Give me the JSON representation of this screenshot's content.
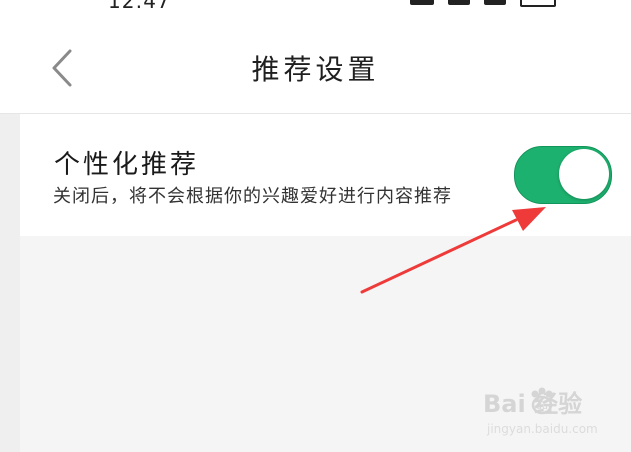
{
  "status_bar": {
    "time": "12:47",
    "icons": [
      "signal-icon",
      "battery-icon"
    ]
  },
  "header": {
    "back_icon": "chevron-left-icon",
    "title": "推荐设置"
  },
  "setting": {
    "title": "个性化推荐",
    "description": "关闭后，将不会根据你的兴趣爱好进行内容推荐",
    "enabled": true
  },
  "watermark": {
    "logo": "Bai  经验",
    "url": "jingyan.baidu.com"
  },
  "colors": {
    "toggle_on": "#1db16f",
    "arrow": "#ef3a3a",
    "background": "#f5f5f5"
  }
}
